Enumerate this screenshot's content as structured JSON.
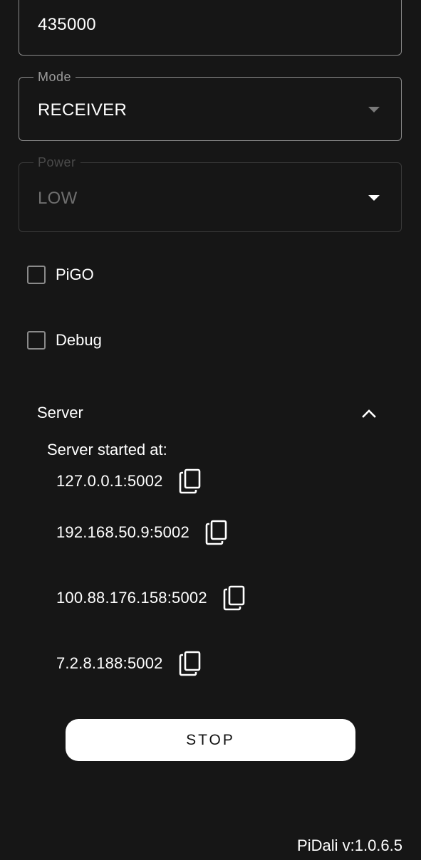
{
  "frequency_field": {
    "value": "435000"
  },
  "mode_field": {
    "label": "Mode",
    "value": "RECEIVER"
  },
  "power_field": {
    "label": "Power",
    "value": "LOW",
    "disabled": true
  },
  "checkboxes": [
    {
      "label": "PiGO",
      "checked": false
    },
    {
      "label": "Debug",
      "checked": false
    }
  ],
  "server": {
    "title": "Server",
    "expanded": true,
    "started_text": "Server started at:",
    "addresses": [
      "127.0.0.1:5002",
      "192.168.50.9:5002",
      "100.88.176.158:5002",
      "7.2.8.188:5002"
    ]
  },
  "stop_button": {
    "label": "STOP"
  },
  "footer": {
    "version": "PiDali v:1.0.6.5"
  },
  "icons": {
    "dropdown": "caret-down-icon",
    "collapse": "chevron-up-icon",
    "copy": "copy-icon"
  },
  "colors": {
    "background": "#161616",
    "text": "#ffffff",
    "border": "#8a8a8a",
    "button_bg": "#ffffff",
    "button_text": "#111111"
  }
}
